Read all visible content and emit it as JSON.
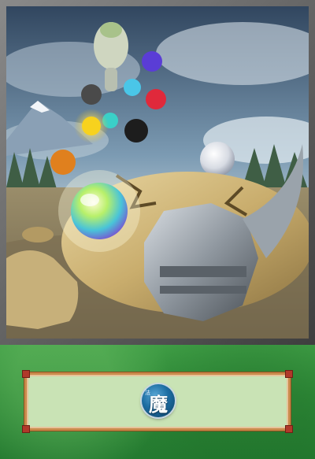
{
  "card": {
    "type_icon": {
      "name": "spell-icon",
      "glyph": "魔",
      "sub_glyph": "法"
    },
    "colors": {
      "frame": "#6c6c6c",
      "panel": "#2f8a38",
      "text_box": "#c9e3b5",
      "text_box_border": "#c98a4b",
      "icon": "#1d6ea3"
    }
  }
}
